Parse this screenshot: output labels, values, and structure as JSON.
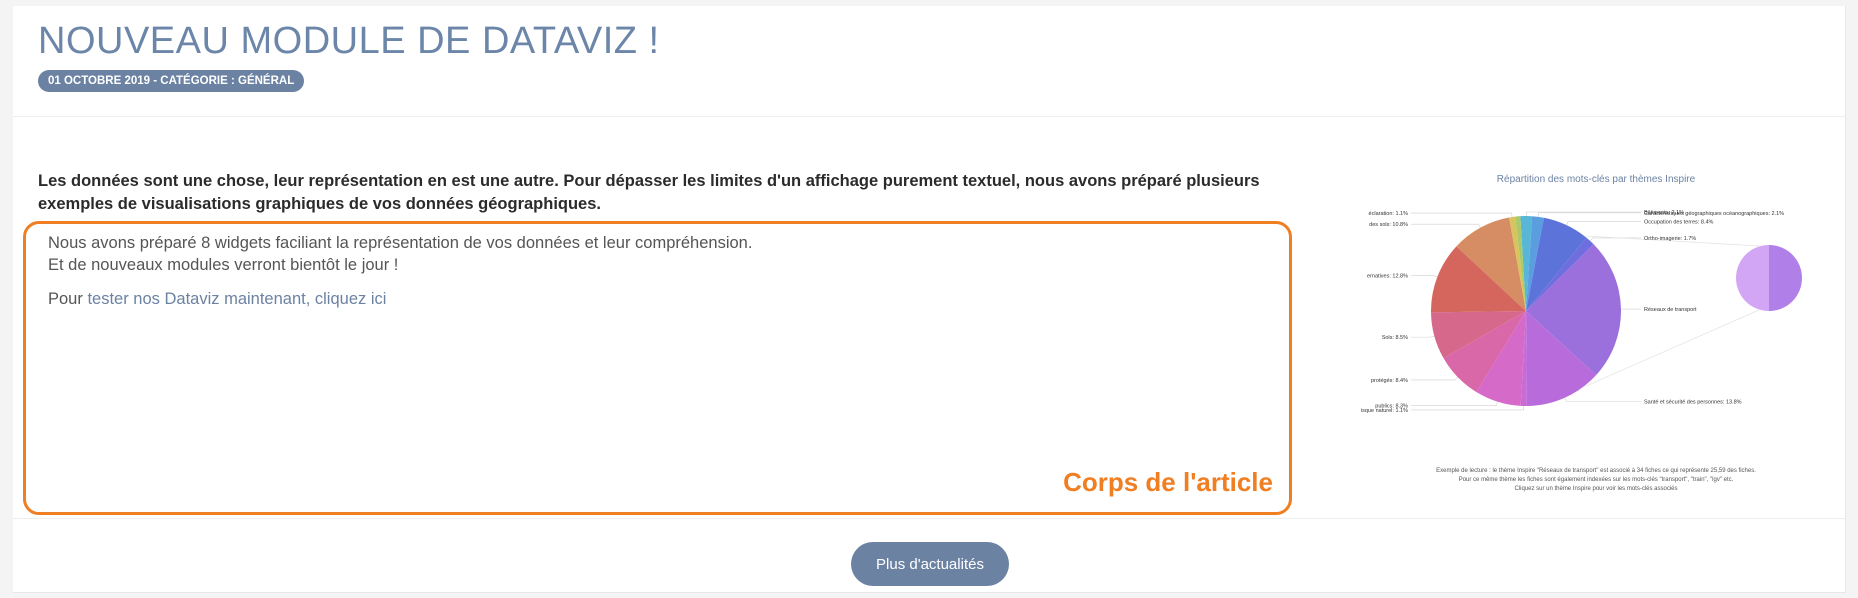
{
  "article": {
    "title": "NOUVEAU MODULE DE DATAVIZ !",
    "meta_badge": "01 OCTOBRE 2019 - CATÉGORIE : GÉNÉRAL",
    "intro": "Les données sont une chose, leur représentation en est une autre. Pour dépasser les limites d'un affichage purement textuel, nous avons préparé plusieurs exemples de visualisations graphiques de vos données géographiques.",
    "body_line_1": "Nous avons préparé 8 widgets faciliant la représentation de vos données et leur compréhension.",
    "body_line_2": "Et de nouveaux modules verront bientôt le jour !",
    "body_line_3_prefix": "Pour ",
    "body_link": "tester nos Dataviz maintenant, cliquez ici",
    "annotation": "Corps de l'article"
  },
  "more_button": "Plus d'actualités",
  "chart_data": {
    "type": "pie",
    "title": "Répartition des mots-clés par thèmes Inspire",
    "slices": [
      {
        "label": "Bâtiments: 2.1%",
        "value": 2.1,
        "color": "#58b7d6"
      },
      {
        "label": "Caractéristiques géographiques océanographiques: 2.1%",
        "value": 2.1,
        "color": "#5a9ee0"
      },
      {
        "label": "Occupation des terres: 8.4%",
        "value": 8.4,
        "color": "#5c73d9"
      },
      {
        "label": "Ortho-imagerie: 1.7%",
        "value": 1.7,
        "color": "#6f6ede"
      },
      {
        "label": "Réseaux de transport",
        "value": 25.5,
        "color": "#9b6fdc"
      },
      {
        "label": "Santé et sécurité des personnes: 13.8%",
        "value": 13.8,
        "color": "#b86cdc"
      },
      {
        "label": "Zones à risque naturel: 1.1%",
        "value": 1.1,
        "color": "#c96bd6"
      },
      {
        "label": "publics: 8.3%",
        "value": 8.3,
        "color": "#d66ac8"
      },
      {
        "label": "protégés: 8.4%",
        "value": 8.4,
        "color": "#d968a8"
      },
      {
        "label": "Sols: 8.5%",
        "value": 8.5,
        "color": "#d6688c"
      },
      {
        "label": "ernatives: 12.8%",
        "value": 12.8,
        "color": "#d4665e"
      },
      {
        "label": "des sols: 10.8%",
        "value": 10.8,
        "color": "#d68d63"
      },
      {
        "label": "éclaration: 1.1%",
        "value": 1.1,
        "color": "#d8c45e"
      },
      {
        "label": "",
        "value": 0.9,
        "color": "#a9c96a"
      }
    ],
    "drilldown": {
      "slices": [
        {
          "value": 50,
          "color": "#b17fe8"
        },
        {
          "value": 50,
          "color": "#d2a6f4"
        }
      ]
    },
    "caption_line_1": "Exemple de lecture : le thème Inspire \"Réseaux de transport\" est associé à 34 fiches ce qui représente 25,59 des fiches.",
    "caption_line_2": "Pour ce même thème les fiches sont également indexées sur les mots-clés \"transport\", \"train\", \"lgv\" etc.",
    "caption_line_3": "Cliquez sur un thème Inspire pour voir les mots-clés associés"
  }
}
